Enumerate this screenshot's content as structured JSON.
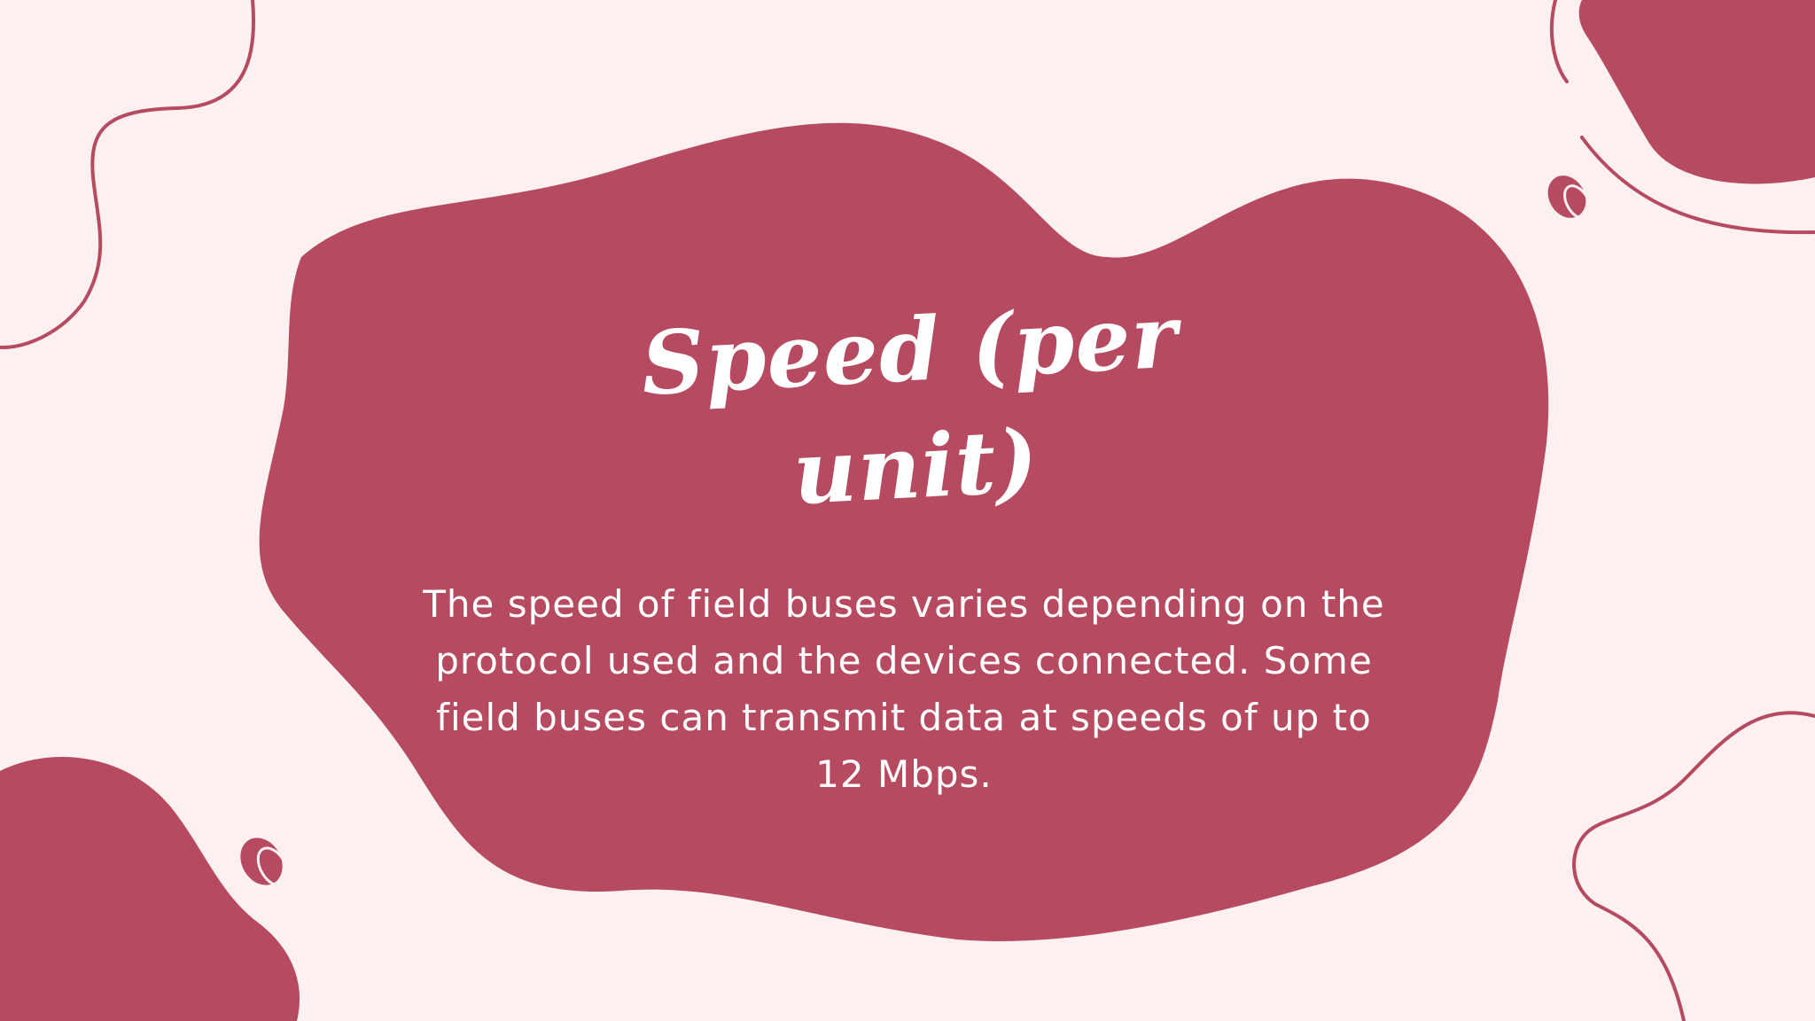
{
  "slide": {
    "title": "Speed (per unit)",
    "body": "The speed of field buses varies depending on the protocol used and the devices connected. Some field buses can transmit data at speeds of up to 12 Mbps."
  },
  "colors": {
    "background": "#fdf0f0",
    "accent": "#b54a61",
    "text": "#ffffff"
  }
}
